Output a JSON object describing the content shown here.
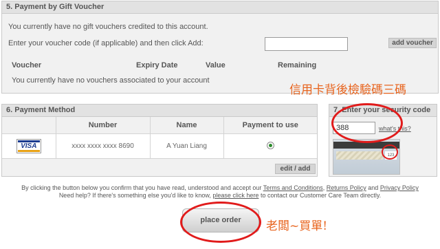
{
  "gift_voucher": {
    "title": "5. Payment by Gift Voucher",
    "no_credit_text": "You currently have no gift vouchers credited to this account.",
    "instruction": "Enter your voucher code (if applicable) and then click Add:",
    "code_value": "",
    "add_button": "add voucher",
    "columns": [
      "Voucher",
      "Expiry Date",
      "Value",
      "Remaining"
    ],
    "empty_text": "You currently have no vouchers associated to your account"
  },
  "payment_method": {
    "title": "6. Payment Method",
    "columns": [
      "",
      "Number",
      "Name",
      "Payment to use"
    ],
    "rows": [
      {
        "card_brand": "VISA",
        "number": "xxxx xxxx xxxx 8690",
        "name": "A Yuan Liang",
        "selected": true
      }
    ],
    "edit_button": "edit / add"
  },
  "security": {
    "title": "7. Enter your security code",
    "code_value": "388",
    "whats_this": "what's this?"
  },
  "terms": {
    "line1_prefix": "By clicking the button below you confirm that you have read, understood and accept our ",
    "terms_link": "Terms and Conditions",
    "sep1": ", ",
    "returns_link": "Returns Policy",
    "sep2": " and ",
    "privacy_link": "Privacy Policy",
    "line2_prefix": "Need help? If there's something else you'd like to know, ",
    "click_here_link": "please click here",
    "line2_suffix": " to contact our Customer Care Team directly."
  },
  "place_order_button": "place order",
  "annotations": {
    "cvv_note": "信用卡背後檢驗碼三碼",
    "order_note": "老闆~買單!",
    "color": "#e8641e",
    "ring_color": "#e11b1b"
  },
  "colors": {
    "panel_bg": "#f1f1f1",
    "panel_header_bg": "#e2e2e2",
    "button_bg": "#d5d5d5",
    "radio_selected": "#2c8a2c",
    "visa_blue": "#1a3a8f",
    "visa_gold": "#e8a217"
  }
}
